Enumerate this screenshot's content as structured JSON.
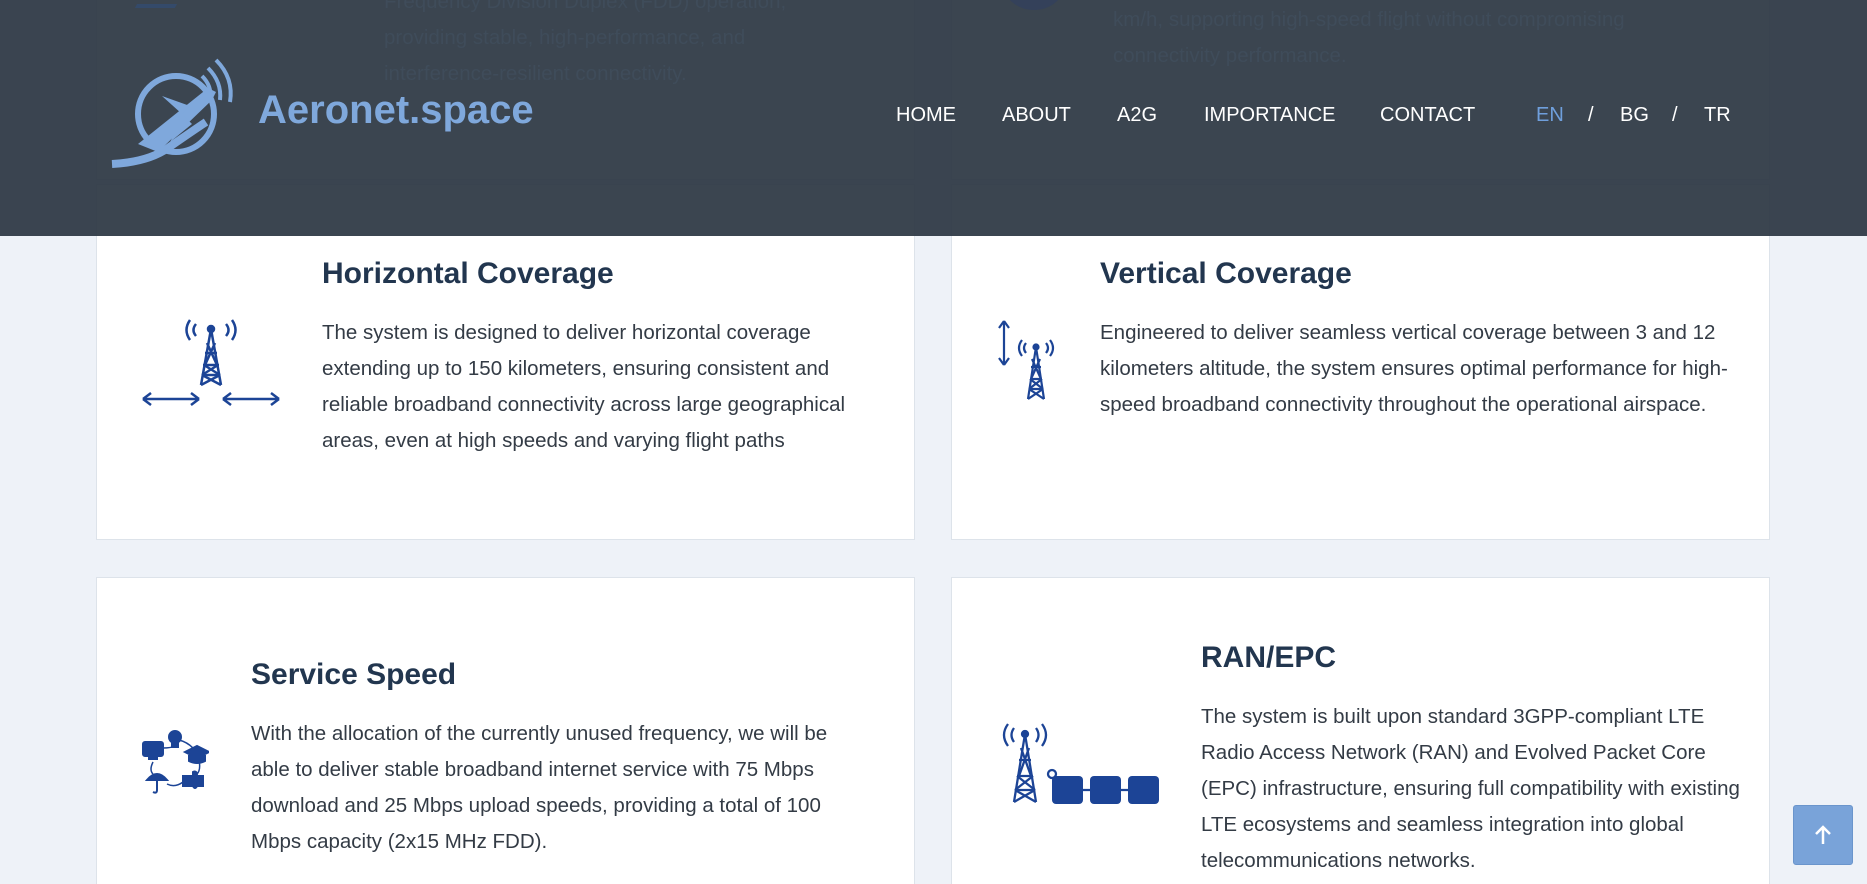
{
  "header": {
    "logo_text": "Aeronet.space",
    "nav": {
      "home": "HOME",
      "about": "ABOUT",
      "a2g": "A2G",
      "importance": "IMPORTANCE",
      "contact": "CONTACT"
    },
    "languages": {
      "en": "EN",
      "sep1": "/",
      "bg": "BG",
      "sep2": "/",
      "tr": "TR"
    },
    "active_language": "EN"
  },
  "behind_header": {
    "left_lines": [
      "Frequency Division Duplex (FDD) operation,",
      "providing stable, high-performance, and",
      "interference-resilient connectivity."
    ],
    "right_lines": [
      "km/h, supporting high-speed flight without compromising",
      "connectivity performance."
    ]
  },
  "cards": [
    {
      "title": "Horizontal Coverage",
      "text": "The system is designed to deliver horizontal coverage extending up to 150 kilometers, ensuring consistent and reliable broadband connectivity across large geographical areas, even at high speeds and varying flight paths",
      "icon": "horizontal-coverage-tower-icon"
    },
    {
      "title": "Vertical Coverage",
      "text": "Engineered to deliver seamless vertical coverage between 3 and 12 kilometers altitude, the system ensures optimal performance for high-speed broadband connectivity throughout the operational airspace.",
      "icon": "vertical-coverage-tower-icon"
    },
    {
      "title": "Service Speed",
      "text": "With the allocation of the currently unused frequency, we will be able to deliver stable broadband internet service with 75 Mbps download and 25 Mbps upload speeds, providing a total of 100 Mbps capacity (2x15 MHz FDD).",
      "icon": "service-speed-icon"
    },
    {
      "title": "RAN/EPC",
      "text": "The system is built upon standard 3GPP-compliant LTE Radio Access Network (RAN) and Evolved Packet Core (EPC) infrastructure, ensuring full compatibility with existing LTE ecosystems and seamless integration into global telecommunications networks.",
      "icon": "ran-epc-network-icon"
    }
  ],
  "colors": {
    "icon_blue": "#1c4496",
    "title": "#22364f",
    "header_bg": "#2c3743",
    "logo_blue": "#7fa8dc",
    "active_lang": "#6f9fdc",
    "to_top_bg": "#79a3d9"
  },
  "to_top_icon": "arrow-up-icon"
}
